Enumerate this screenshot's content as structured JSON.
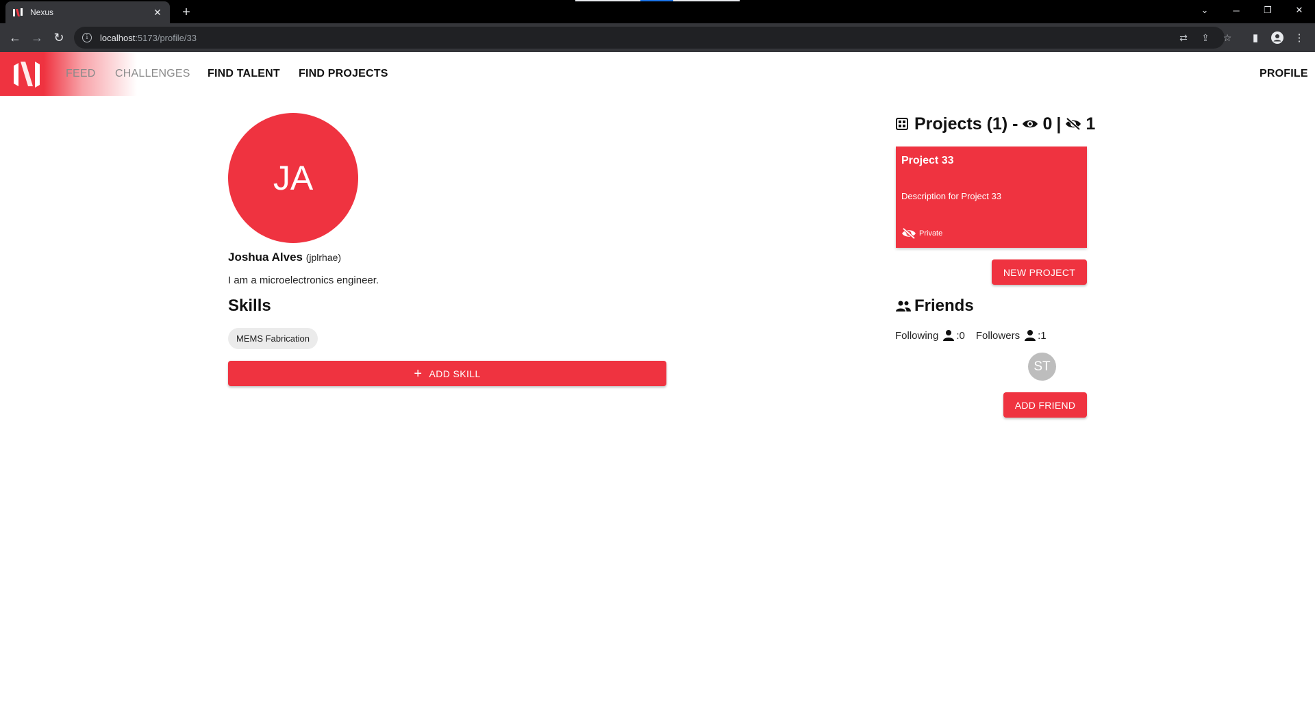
{
  "browser": {
    "tab_title": "Nexus",
    "tab_close": "✕",
    "new_tab": "+",
    "url_host": "localhost",
    "url_path": ":5173/profile/33"
  },
  "nav": {
    "items": [
      {
        "label": "FEED",
        "state": "muted"
      },
      {
        "label": "CHALLENGES",
        "state": "muted"
      },
      {
        "label": "FIND TALENT",
        "state": "active"
      },
      {
        "label": "FIND PROJECTS",
        "state": "active"
      }
    ],
    "profile": "PROFILE"
  },
  "profile": {
    "initials": "JA",
    "name": "Joshua Alves",
    "username": "(jplrhae)",
    "bio": "I am a microelectronics engineer.",
    "skills_heading": "Skills",
    "skills": [
      "MEMS Fabrication"
    ],
    "add_skill_label": "ADD SKILL"
  },
  "projects": {
    "heading": "Projects (1) -",
    "public_count": "0",
    "separator": "|",
    "private_count": "1",
    "card": {
      "title": "Project 33",
      "description": "Description for Project 33",
      "status": "Private"
    },
    "new_project_label": "NEW PROJECT"
  },
  "friends": {
    "heading": "Friends",
    "following_label": "Following",
    "following_count": ":0",
    "followers_label": "Followers",
    "followers_count": ":1",
    "follower_initials": "ST",
    "add_friend_label": "ADD FRIEND"
  },
  "colors": {
    "brand": "#ef3340",
    "chip": "#ebebeb",
    "friend_avatar": "#bdbdbd"
  }
}
